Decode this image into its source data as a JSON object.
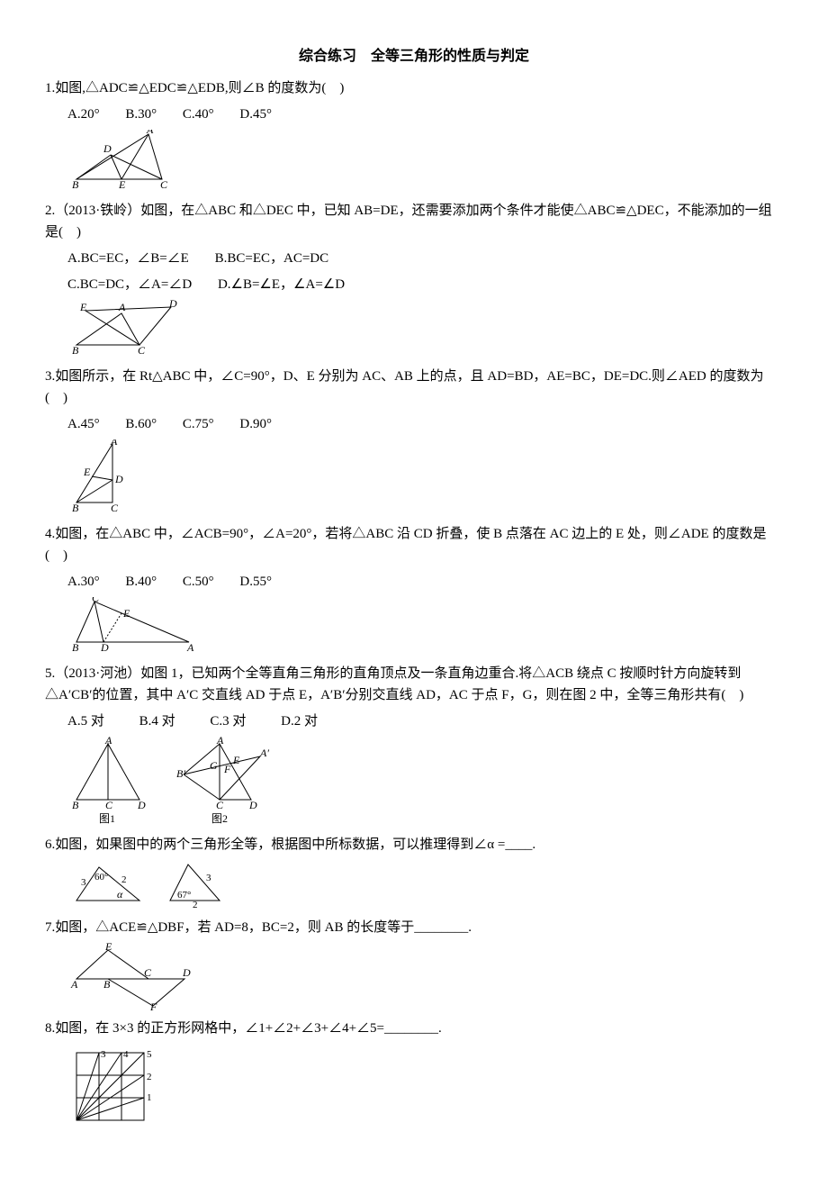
{
  "title": "综合练习　全等三角形的性质与判定",
  "q1": {
    "text": "1.如图,△ADC≌△EDC≌△EDB,则∠B 的度数为(　)",
    "a": "A.20°",
    "b": "B.30°",
    "c": "C.40°",
    "d": "D.45°"
  },
  "q2": {
    "text": "2.（2013·铁岭）如图，在△ABC 和△DEC 中，已知 AB=DE，还需要添加两个条件才能使△ABC≌△DEC，不能添加的一组是(　)",
    "a": "A.BC=EC，∠B=∠E",
    "b": "B.BC=EC，AC=DC",
    "c": "C.BC=DC，∠A=∠D",
    "d": "D.∠B=∠E，∠A=∠D"
  },
  "q3": {
    "text": "3.如图所示，在 Rt△ABC 中，∠C=90°，D、E 分别为 AC、AB 上的点，且 AD=BD，AE=BC，DE=DC.则∠AED 的度数为(　)",
    "a": "A.45°",
    "b": "B.60°",
    "c": "C.75°",
    "d": "D.90°"
  },
  "q4": {
    "text": "4.如图，在△ABC 中，∠ACB=90°，∠A=20°，若将△ABC 沿 CD 折叠，使 B 点落在 AC 边上的 E 处，则∠ADE 的度数是(　)",
    "a": "A.30°",
    "b": "B.40°",
    "c": "C.50°",
    "d": "D.55°"
  },
  "q5": {
    "text": "5.（2013·河池）如图 1，已知两个全等直角三角形的直角顶点及一条直角边重合.将△ACB 绕点 C 按顺时针方向旋转到△A′CB′的位置，其中 A′C 交直线 AD 于点 E，A′B′分别交直线 AD，AC 于点 F，G，则在图 2 中，全等三角形共有(　)",
    "a": "A.5 对",
    "b": "B.4 对",
    "c": "C.3 对",
    "d": "D.2 对",
    "fig1": "图1",
    "fig2": "图2"
  },
  "q6": {
    "text": "6.如图，如果图中的两个三角形全等，根据图中所标数据，可以推理得到∠α =____."
  },
  "q7": {
    "text": "7.如图，△ACE≌△DBF，若 AD=8，BC=2，则 AB 的长度等于________."
  },
  "q8": {
    "text": "8.如图，在 3×3 的正方形网格中，∠1+∠2+∠3+∠4+∠5=________."
  }
}
